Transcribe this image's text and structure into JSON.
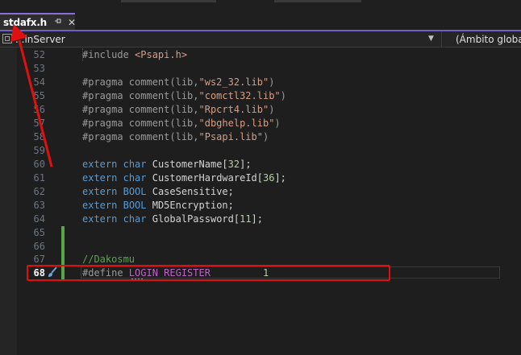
{
  "tab": {
    "label": "stdafx.h",
    "pin_icon": "pin-icon",
    "close_symbol": "✕"
  },
  "nav": {
    "project": "LoginServer",
    "project_visible": "...inServer",
    "scope": "(Ámbito global)"
  },
  "editor": {
    "lines": [
      {
        "no": "52",
        "text": "#include <Psapi.h>"
      },
      {
        "no": "53",
        "text": ""
      },
      {
        "no": "54",
        "text": "#pragma comment(lib,\"ws2_32.lib\")"
      },
      {
        "no": "55",
        "text": "#pragma comment(lib,\"comctl32.lib\")"
      },
      {
        "no": "56",
        "text": "#pragma comment(lib,\"Rpcrt4.lib\")"
      },
      {
        "no": "57",
        "text": "#pragma comment(lib,\"dbghelp.lib\")"
      },
      {
        "no": "58",
        "text": "#pragma comment(lib,\"Psapi.lib\")"
      },
      {
        "no": "59",
        "text": ""
      },
      {
        "no": "60",
        "text": "extern char CustomerName[32];"
      },
      {
        "no": "61",
        "text": "extern char CustomerHardwareId[36];"
      },
      {
        "no": "62",
        "text": "extern BOOL CaseSensitive;"
      },
      {
        "no": "63",
        "text": "extern BOOL MD5Encryption;"
      },
      {
        "no": "64",
        "text": "extern char GlobalPassword[11];"
      },
      {
        "no": "65",
        "text": ""
      },
      {
        "no": "66",
        "text": ""
      },
      {
        "no": "67",
        "text": "//Dakosmu"
      },
      {
        "no": "68",
        "text": "#define LOGIN_REGISTER         1"
      }
    ],
    "current_line": "68"
  },
  "colors": {
    "keyword": "#569cd6",
    "string": "#d69d85",
    "comment": "#57a64a",
    "macro": "#bd63c5",
    "annotation": "#e01010"
  }
}
